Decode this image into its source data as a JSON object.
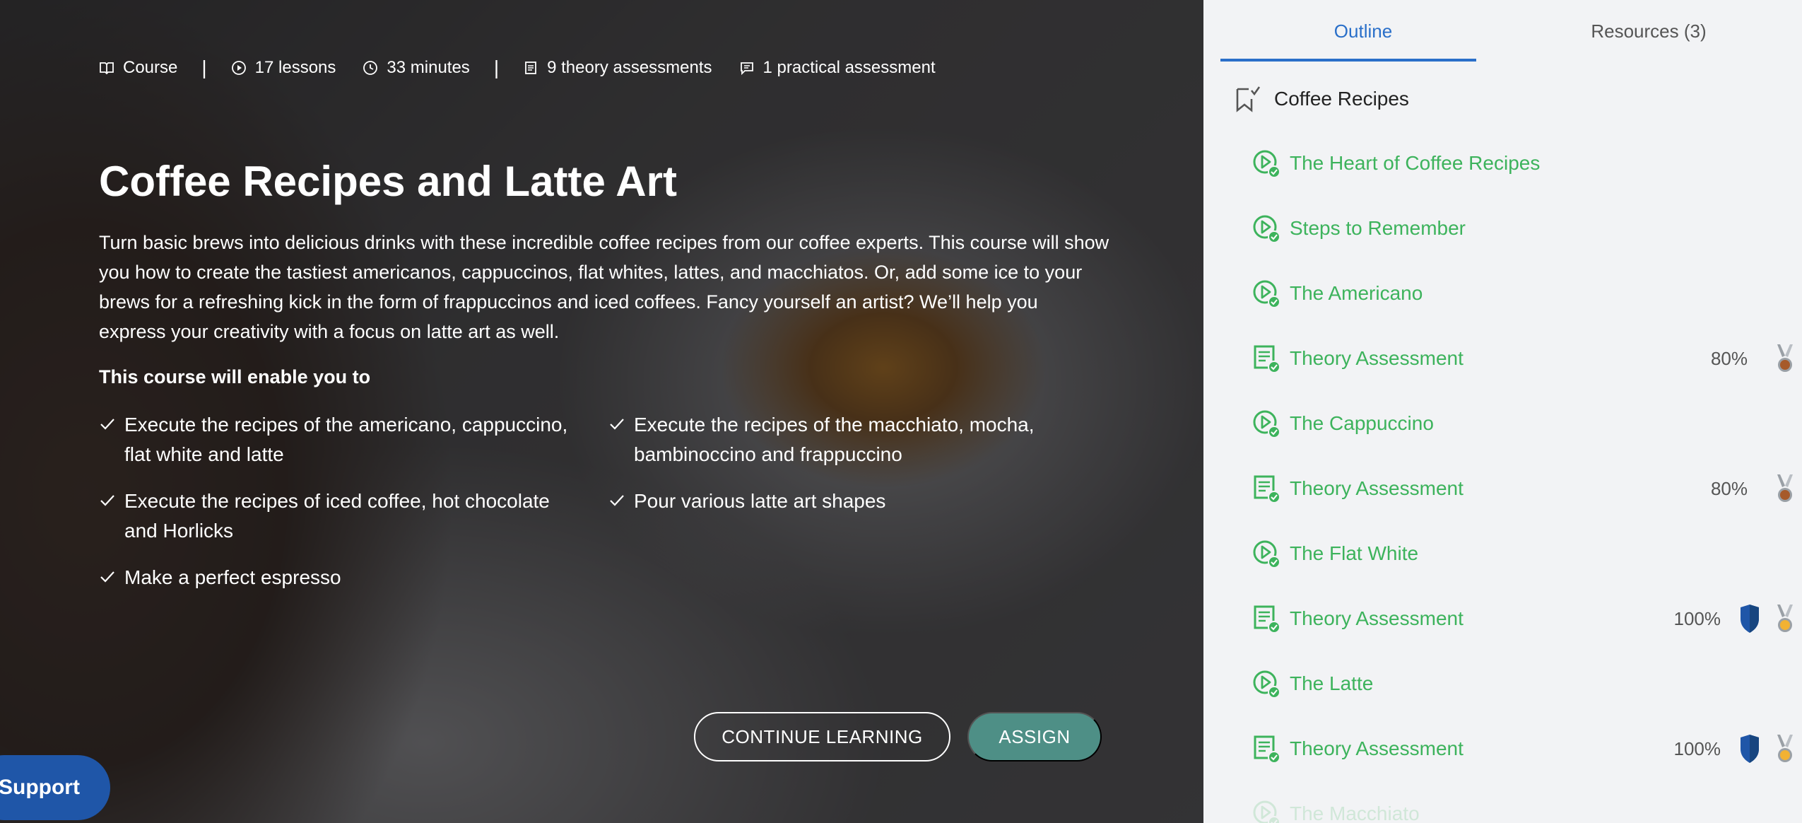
{
  "hero": {
    "meta": [
      {
        "icon": "book-icon",
        "label": "Course"
      },
      {
        "icon": "play-circle-icon",
        "label": "17 lessons"
      },
      {
        "icon": "clock-icon",
        "label": "33 minutes"
      },
      {
        "icon": "document-icon",
        "label": "9 theory assessments"
      },
      {
        "icon": "chat-icon",
        "label": "1 practical assessment"
      }
    ],
    "separator": "|",
    "title": "Coffee Recipes and Latte Art",
    "description": "Turn basic brews into delicious drinks with these incredible coffee recipes from our coffee experts. This course will show you how to create the tastiest americanos, cappuccinos, flat whites, lattes, and macchiatos. Or, add some ice to your brews for a refreshing kick in the form of frappuccinos and iced coffees. Fancy yourself an artist? We’ll help you express your creativity with a focus on latte art as well.",
    "enable_heading": "This course will enable you to",
    "objectives": [
      "Execute the recipes of the americano, cappuccino, flat white and latte",
      "Execute the recipes of the macchiato, mocha, bambinoccino and frappuccino",
      "Execute the recipes of iced coffee, hot chocolate and Horlicks",
      "Pour various latte art shapes",
      "Make a perfect espresso"
    ],
    "continue_label": "CONTINUE LEARNING",
    "assign_label": "ASSIGN",
    "support_label": "Support"
  },
  "sidebar": {
    "tabs": [
      "Outline",
      "Resources (3)"
    ],
    "module_title": "Coffee Recipes",
    "items": [
      {
        "type": "video",
        "title": "The Heart of Coffee Recipes",
        "score": "",
        "shield": false,
        "medal": ""
      },
      {
        "type": "video",
        "title": "Steps to Remember",
        "score": "",
        "shield": false,
        "medal": ""
      },
      {
        "type": "video",
        "title": "The Americano",
        "score": "",
        "shield": false,
        "medal": ""
      },
      {
        "type": "assessment",
        "title": "Theory Assessment",
        "score": "80%",
        "shield": false,
        "medal": "bronze"
      },
      {
        "type": "video",
        "title": "The Cappuccino",
        "score": "",
        "shield": false,
        "medal": ""
      },
      {
        "type": "assessment",
        "title": "Theory Assessment",
        "score": "80%",
        "shield": false,
        "medal": "bronze"
      },
      {
        "type": "video",
        "title": "The Flat White",
        "score": "",
        "shield": false,
        "medal": ""
      },
      {
        "type": "assessment",
        "title": "Theory Assessment",
        "score": "100%",
        "shield": true,
        "medal": "gold"
      },
      {
        "type": "video",
        "title": "The Latte",
        "score": "",
        "shield": false,
        "medal": ""
      },
      {
        "type": "assessment",
        "title": "Theory Assessment",
        "score": "100%",
        "shield": true,
        "medal": "gold"
      },
      {
        "type": "video",
        "title": "The Macchiato",
        "score": "",
        "shield": false,
        "medal": ""
      }
    ]
  },
  "colors": {
    "accent_blue": "#2a6fc9",
    "complete_green": "#3db35c",
    "assign_teal": "#4e8f86",
    "support_blue": "#1f56a8",
    "shield_blue": "#1f56a8",
    "bronze": "#a65a2a",
    "gold": "#f2b233"
  }
}
